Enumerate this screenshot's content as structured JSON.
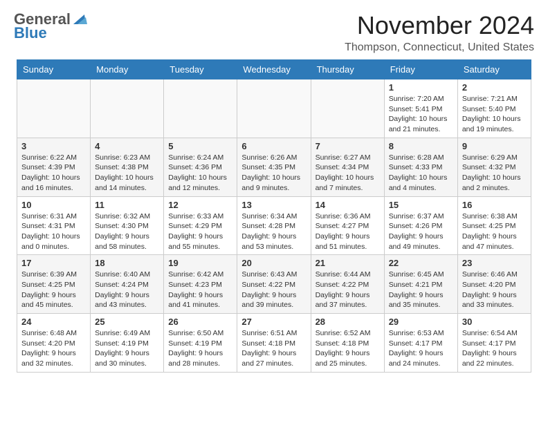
{
  "header": {
    "logo_general": "General",
    "logo_blue": "Blue",
    "month_title": "November 2024",
    "location": "Thompson, Connecticut, United States"
  },
  "calendar": {
    "days_of_week": [
      "Sunday",
      "Monday",
      "Tuesday",
      "Wednesday",
      "Thursday",
      "Friday",
      "Saturday"
    ],
    "weeks": [
      [
        {
          "day": "",
          "info": "",
          "empty": true
        },
        {
          "day": "",
          "info": "",
          "empty": true
        },
        {
          "day": "",
          "info": "",
          "empty": true
        },
        {
          "day": "",
          "info": "",
          "empty": true
        },
        {
          "day": "",
          "info": "",
          "empty": true
        },
        {
          "day": "1",
          "info": "Sunrise: 7:20 AM\nSunset: 5:41 PM\nDaylight: 10 hours\nand 21 minutes."
        },
        {
          "day": "2",
          "info": "Sunrise: 7:21 AM\nSunset: 5:40 PM\nDaylight: 10 hours\nand 19 minutes."
        }
      ],
      [
        {
          "day": "3",
          "info": "Sunrise: 6:22 AM\nSunset: 4:39 PM\nDaylight: 10 hours\nand 16 minutes."
        },
        {
          "day": "4",
          "info": "Sunrise: 6:23 AM\nSunset: 4:38 PM\nDaylight: 10 hours\nand 14 minutes."
        },
        {
          "day": "5",
          "info": "Sunrise: 6:24 AM\nSunset: 4:36 PM\nDaylight: 10 hours\nand 12 minutes."
        },
        {
          "day": "6",
          "info": "Sunrise: 6:26 AM\nSunset: 4:35 PM\nDaylight: 10 hours\nand 9 minutes."
        },
        {
          "day": "7",
          "info": "Sunrise: 6:27 AM\nSunset: 4:34 PM\nDaylight: 10 hours\nand 7 minutes."
        },
        {
          "day": "8",
          "info": "Sunrise: 6:28 AM\nSunset: 4:33 PM\nDaylight: 10 hours\nand 4 minutes."
        },
        {
          "day": "9",
          "info": "Sunrise: 6:29 AM\nSunset: 4:32 PM\nDaylight: 10 hours\nand 2 minutes."
        }
      ],
      [
        {
          "day": "10",
          "info": "Sunrise: 6:31 AM\nSunset: 4:31 PM\nDaylight: 10 hours\nand 0 minutes."
        },
        {
          "day": "11",
          "info": "Sunrise: 6:32 AM\nSunset: 4:30 PM\nDaylight: 9 hours\nand 58 minutes."
        },
        {
          "day": "12",
          "info": "Sunrise: 6:33 AM\nSunset: 4:29 PM\nDaylight: 9 hours\nand 55 minutes."
        },
        {
          "day": "13",
          "info": "Sunrise: 6:34 AM\nSunset: 4:28 PM\nDaylight: 9 hours\nand 53 minutes."
        },
        {
          "day": "14",
          "info": "Sunrise: 6:36 AM\nSunset: 4:27 PM\nDaylight: 9 hours\nand 51 minutes."
        },
        {
          "day": "15",
          "info": "Sunrise: 6:37 AM\nSunset: 4:26 PM\nDaylight: 9 hours\nand 49 minutes."
        },
        {
          "day": "16",
          "info": "Sunrise: 6:38 AM\nSunset: 4:25 PM\nDaylight: 9 hours\nand 47 minutes."
        }
      ],
      [
        {
          "day": "17",
          "info": "Sunrise: 6:39 AM\nSunset: 4:25 PM\nDaylight: 9 hours\nand 45 minutes."
        },
        {
          "day": "18",
          "info": "Sunrise: 6:40 AM\nSunset: 4:24 PM\nDaylight: 9 hours\nand 43 minutes."
        },
        {
          "day": "19",
          "info": "Sunrise: 6:42 AM\nSunset: 4:23 PM\nDaylight: 9 hours\nand 41 minutes."
        },
        {
          "day": "20",
          "info": "Sunrise: 6:43 AM\nSunset: 4:22 PM\nDaylight: 9 hours\nand 39 minutes."
        },
        {
          "day": "21",
          "info": "Sunrise: 6:44 AM\nSunset: 4:22 PM\nDaylight: 9 hours\nand 37 minutes."
        },
        {
          "day": "22",
          "info": "Sunrise: 6:45 AM\nSunset: 4:21 PM\nDaylight: 9 hours\nand 35 minutes."
        },
        {
          "day": "23",
          "info": "Sunrise: 6:46 AM\nSunset: 4:20 PM\nDaylight: 9 hours\nand 33 minutes."
        }
      ],
      [
        {
          "day": "24",
          "info": "Sunrise: 6:48 AM\nSunset: 4:20 PM\nDaylight: 9 hours\nand 32 minutes."
        },
        {
          "day": "25",
          "info": "Sunrise: 6:49 AM\nSunset: 4:19 PM\nDaylight: 9 hours\nand 30 minutes."
        },
        {
          "day": "26",
          "info": "Sunrise: 6:50 AM\nSunset: 4:19 PM\nDaylight: 9 hours\nand 28 minutes."
        },
        {
          "day": "27",
          "info": "Sunrise: 6:51 AM\nSunset: 4:18 PM\nDaylight: 9 hours\nand 27 minutes."
        },
        {
          "day": "28",
          "info": "Sunrise: 6:52 AM\nSunset: 4:18 PM\nDaylight: 9 hours\nand 25 minutes."
        },
        {
          "day": "29",
          "info": "Sunrise: 6:53 AM\nSunset: 4:17 PM\nDaylight: 9 hours\nand 24 minutes."
        },
        {
          "day": "30",
          "info": "Sunrise: 6:54 AM\nSunset: 4:17 PM\nDaylight: 9 hours\nand 22 minutes."
        }
      ]
    ]
  }
}
